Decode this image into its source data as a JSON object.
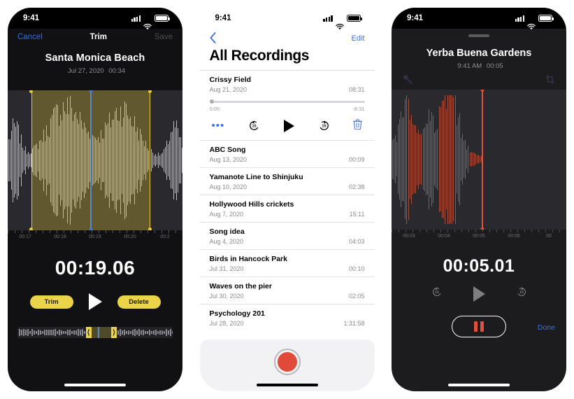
{
  "status_bar": {
    "time": "9:41",
    "signal_icon": "cellular-bars-icon",
    "wifi_icon": "wifi-icon",
    "battery_icon": "battery-icon"
  },
  "accent_colors": {
    "yellow": "#ecd44a",
    "blue": "#3c6fe0",
    "red": "#e0503a",
    "dark_bg": "#1c1c1e",
    "wave_bg": "#2a2a2e"
  },
  "trim_screen": {
    "nav": {
      "cancel": "Cancel",
      "title": "Trim",
      "save": "Save"
    },
    "recording_title": "Santa Monica Beach",
    "recording_date": "Jul 27, 2020",
    "recording_duration": "00:34",
    "ruler_labels": [
      "00:17",
      "00:18",
      "00:19",
      "00:20",
      "00:2"
    ],
    "current_time": "00:19.06",
    "buttons": {
      "trim": "Trim",
      "play": "play-icon",
      "delete": "Delete"
    },
    "selection": {
      "start_pct": 13.5,
      "end_pct": 81.5,
      "playhead_pct": 47.5
    }
  },
  "list_screen": {
    "back_icon": "chevron-left-icon",
    "edit": "Edit",
    "title": "All Recordings",
    "expanded_item": {
      "name": "Crissy Field",
      "date": "Aug 21, 2020",
      "duration": "08:31",
      "elapsed": "0:00",
      "remaining": "-8:31",
      "progress_pct": 0,
      "controls": {
        "more": "more-options-icon",
        "back15": "skip-back-15-icon",
        "play": "play-icon",
        "forward15": "skip-forward-15-icon",
        "delete": "trash-icon"
      }
    },
    "items": [
      {
        "name": "ABC Song",
        "date": "Aug 13, 2020",
        "duration": "00:09"
      },
      {
        "name": "Yamanote Line to Shinjuku",
        "date": "Aug 10, 2020",
        "duration": "02:38"
      },
      {
        "name": "Hollywood Hills crickets",
        "date": "Aug 7, 2020",
        "duration": "15:11"
      },
      {
        "name": "Song idea",
        "date": "Aug 4, 2020",
        "duration": "04:03"
      },
      {
        "name": "Birds in Hancock Park",
        "date": "Jul 31, 2020",
        "duration": "00:10"
      },
      {
        "name": "Waves on the pier",
        "date": "Jul 30, 2020",
        "duration": "02:05"
      },
      {
        "name": "Psychology 201",
        "date": "Jul 28, 2020",
        "duration": "1:31:58"
      }
    ],
    "record_button": "record-button"
  },
  "player_screen": {
    "grabber": "sheet-grabber",
    "recording_title": "Yerba Buena Gardens",
    "recording_time": "9:41 AM",
    "recording_duration": "00:05",
    "tools": {
      "enhance": "magic-wand-icon",
      "crop": "crop-trim-icon"
    },
    "ruler_labels": [
      "00:03",
      "00:04",
      "00:05",
      "00:06",
      "00"
    ],
    "current_time": "00:05.01",
    "controls": {
      "back15": "skip-back-15-icon",
      "play": "play-icon",
      "forward15": "skip-forward-15-icon",
      "pause": "pause-icon"
    },
    "done": "Done",
    "playhead_pct": 52
  }
}
